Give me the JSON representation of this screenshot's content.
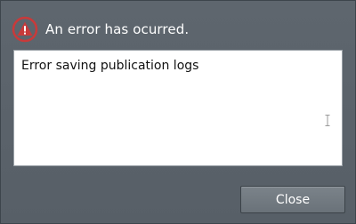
{
  "dialog": {
    "title": "An error has ocurred.",
    "icon": "warning-icon",
    "message": "Error saving publication logs",
    "close_label": "Close"
  },
  "colors": {
    "background": "#5b636b",
    "icon_red": "#c83a3a",
    "button": "#737b82",
    "text_light": "#ffffff"
  }
}
